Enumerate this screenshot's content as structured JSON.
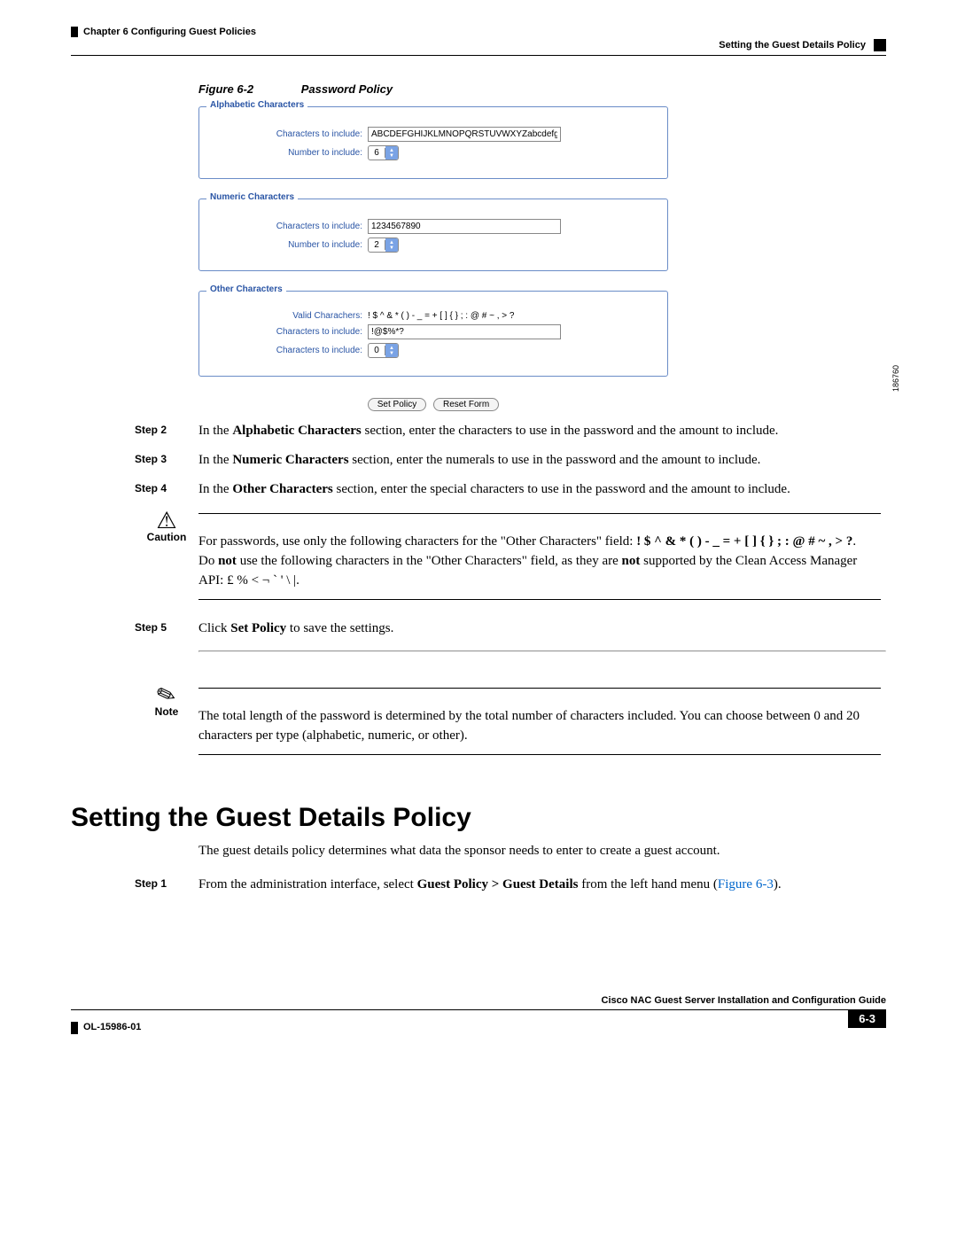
{
  "header": {
    "chapter": "Chapter 6    Configuring Guest Policies",
    "section": "Setting the Guest Details Policy"
  },
  "figure": {
    "label": "Figure 6-2",
    "title": "Password Policy",
    "side_num": "186760"
  },
  "fieldsets": {
    "alphabetic": {
      "legend": "Alphabetic Characters",
      "chars_label": "Characters to include:",
      "chars_value": "ABCDEFGHIJKLMNOPQRSTUVWXYZabcdefghijklmnopqrstu",
      "num_label": "Number to include:",
      "num_value": "6"
    },
    "numeric": {
      "legend": "Numeric Characters",
      "chars_label": "Characters to include:",
      "chars_value": "1234567890",
      "num_label": "Number to include:",
      "num_value": "2"
    },
    "other": {
      "legend": "Other Characters",
      "valid_label": "Valid Charachers:",
      "valid_value": "! $ ^ & * ( ) - _ = + [ ] { } ; : @ # ~ , > ?",
      "chars_label": "Characters to include:",
      "chars_value": "!@$%*?",
      "num_label": "Characters to include:",
      "num_value": "0"
    }
  },
  "buttons": {
    "set": "Set Policy",
    "reset": "Reset Form"
  },
  "steps": {
    "s2_label": "Step 2",
    "s2_a": "In the ",
    "s2_b": "Alphabetic Characters",
    "s2_c": " section, enter the characters to use in the password and the amount to include.",
    "s3_label": "Step 3",
    "s3_a": "In the ",
    "s3_b": "Numeric Characters",
    "s3_c": " section, enter the numerals to use in the password and the amount to include.",
    "s4_label": "Step 4",
    "s4_a": "In the ",
    "s4_b": "Other Characters",
    "s4_c": " section, enter the special characters to use in the password and the amount to include.",
    "s5_label": "Step 5",
    "s5_a": "Click ",
    "s5_b": "Set Policy",
    "s5_c": " to save the settings."
  },
  "caution": {
    "label": "Caution",
    "a": "For passwords, use only the following characters for the \"Other Characters\" field: ",
    "b": "! $ ^ & * ( ) - _ = + [ ] { } ; : @ # ~ , > ?",
    "c": ".",
    "d1": "Do ",
    "d2": "not",
    "d3": " use the following characters in the \"Other Characters\" field, as they are ",
    "d4": "not",
    "d5": " supported by the Clean Access Manager API: £ % < ¬ ` ' \\ |."
  },
  "note": {
    "label": "Note",
    "text": "The total length of the password is determined by the total number of characters included. You can choose between 0 and 20 characters per type (alphabetic, numeric, or other)."
  },
  "section2": {
    "heading": "Setting the Guest Details Policy",
    "intro": "The guest details policy determines what data the sponsor needs to enter to create a guest account.",
    "s1_label": "Step 1",
    "s1_a": "From the administration interface, select ",
    "s1_b": "Guest Policy > Guest Details",
    "s1_c": " from the left hand menu (",
    "s1_link": "Figure 6-3",
    "s1_d": ")."
  },
  "footer": {
    "title": "Cisco NAC Guest Server Installation and Configuration Guide",
    "docnum": "OL-15986-01",
    "pagenum": "6-3"
  }
}
